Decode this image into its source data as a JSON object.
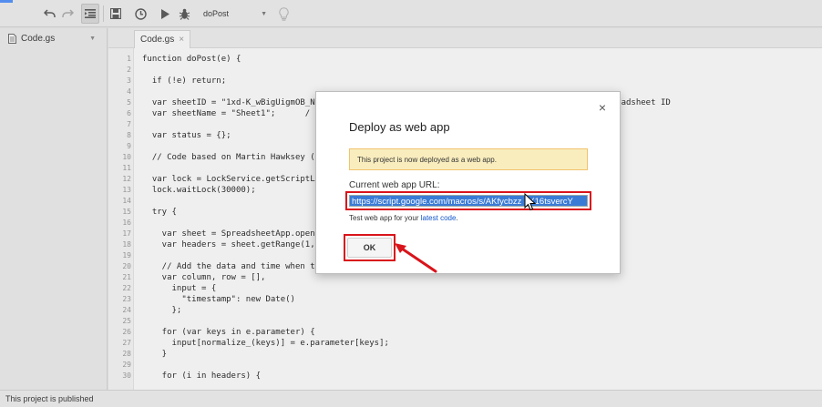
{
  "toolbar": {
    "function_select": "doPost",
    "icons": [
      "undo-icon",
      "redo-icon",
      "indent-icon",
      "save-icon",
      "triggers-icon",
      "run-icon",
      "debug-icon",
      "lightbulb-icon"
    ]
  },
  "files": {
    "items": [
      {
        "label": "Code.gs"
      }
    ]
  },
  "editor": {
    "tab_label": "Code.gs",
    "tab_close": "×",
    "lines": [
      {
        "n": "1",
        "t": "function doPost(e) {"
      },
      {
        "n": "2",
        "t": ""
      },
      {
        "n": "3",
        "t": "  if (!e) return;"
      },
      {
        "n": "4",
        "t": ""
      },
      {
        "n": "5",
        "t": "  var sheetID = \"1xd-K_wBigUigmOB_N                                                          Spreadsheet ID"
      },
      {
        "n": "6",
        "t": "  var sheetName = \"Sheet1\";      /"
      },
      {
        "n": "7",
        "t": ""
      },
      {
        "n": "8",
        "t": "  var status = {};"
      },
      {
        "n": "9",
        "t": ""
      },
      {
        "n": "10",
        "t": "  // Code based on Martin Hawksey ("
      },
      {
        "n": "11",
        "t": ""
      },
      {
        "n": "12",
        "t": "  var lock = LockService.getScriptL"
      },
      {
        "n": "13",
        "t": "  lock.waitLock(30000);"
      },
      {
        "n": "14",
        "t": ""
      },
      {
        "n": "15",
        "t": "  try {"
      },
      {
        "n": "16",
        "t": ""
      },
      {
        "n": "17",
        "t": "    var sheet = SpreadsheetApp.open"
      },
      {
        "n": "18",
        "t": "    var headers = sheet.getRange(1,"
      },
      {
        "n": "19",
        "t": ""
      },
      {
        "n": "20",
        "t": "    // Add the data and time when t"
      },
      {
        "n": "21",
        "t": "    var column, row = [],"
      },
      {
        "n": "22",
        "t": "      input = {"
      },
      {
        "n": "23",
        "t": "        \"timestamp\": new Date()"
      },
      {
        "n": "24",
        "t": "      };"
      },
      {
        "n": "25",
        "t": ""
      },
      {
        "n": "26",
        "t": "    for (var keys in e.parameter) {"
      },
      {
        "n": "27",
        "t": "      input[normalize_(keys)] = e.parameter[keys];"
      },
      {
        "n": "28",
        "t": "    }"
      },
      {
        "n": "29",
        "t": ""
      },
      {
        "n": "30",
        "t": "    for (i in headers) {"
      }
    ]
  },
  "status": {
    "text": "This project is published"
  },
  "dialog": {
    "title": "Deploy as web app",
    "close": "×",
    "notice": "This project is now deployed as a web app.",
    "url_label": "Current web app URL:",
    "url_value": "https://script.google.com/macros/s/AKfycbzz   3X16tsvercY",
    "test_prefix": "Test web app for your ",
    "test_link": "latest code",
    "test_suffix": ".",
    "ok_label": "OK"
  },
  "colors": {
    "highlight_box": "#d9141b",
    "notice_bg": "#f9edbe",
    "selection": "#3a7bd5",
    "link": "#1155cc"
  }
}
